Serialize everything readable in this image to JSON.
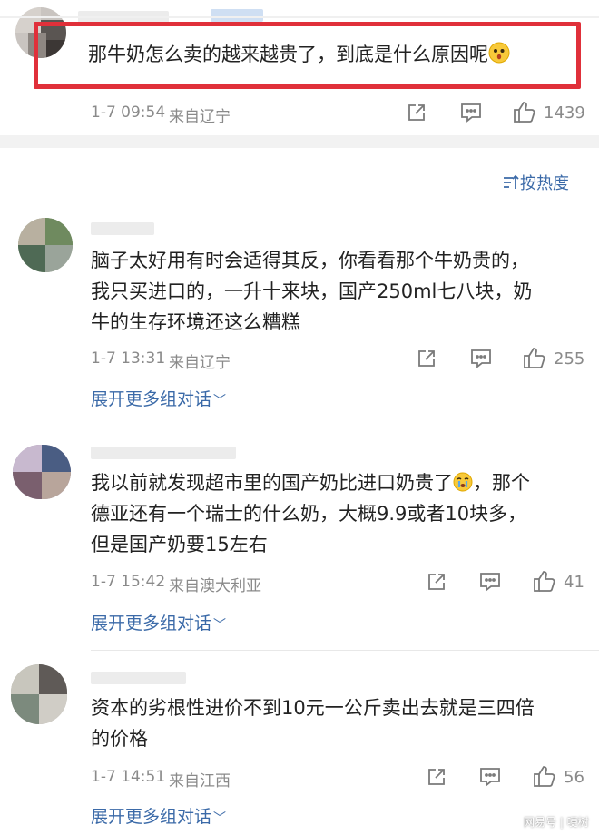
{
  "top_comment": {
    "text": "那牛奶怎么卖的越来越贵了，到底是什么原因呢",
    "date": "1-7 09:54",
    "location": "来自辽宁",
    "likes": "1439",
    "emoji": "thinking-face-icon"
  },
  "sort": {
    "label": "按热度",
    "icon": "sort-icon"
  },
  "replies": [
    {
      "lines": [
        "脑子太好用有时会适得其反，你看看那个牛奶贵的，",
        "我只买进口的，一升十来块，国产250ml七八块，奶",
        "牛的生存环境还这么糟糕"
      ],
      "date": "1-7 13:31",
      "location": "来自辽宁",
      "likes": "255",
      "expand": "展开更多组对话"
    },
    {
      "lines": [
        "我以前就发现超市里的国产奶比进口奶贵了",
        "德亚还有一个瑞士的什么奶，大概9.9或者10块多，",
        "但是国产奶要15左右"
      ],
      "line1_tail": "，那个",
      "date": "1-7 15:42",
      "location": "来自澳大利亚",
      "likes": "41",
      "expand": "展开更多组对话",
      "emoji": "crying-face-icon"
    },
    {
      "lines": [
        "资本的劣根性进价不到10元一公斤卖出去就是三四倍",
        "的价格"
      ],
      "date": "1-7 14:51",
      "location": "来自江西",
      "likes": "56",
      "expand": "展开更多组对话"
    }
  ],
  "watermark": "网易号 | 哽树",
  "colors": {
    "highlight": "#e0303a",
    "link": "#3b6aa8",
    "meta": "#8a8a8a",
    "divider": "#f2f2f2"
  }
}
